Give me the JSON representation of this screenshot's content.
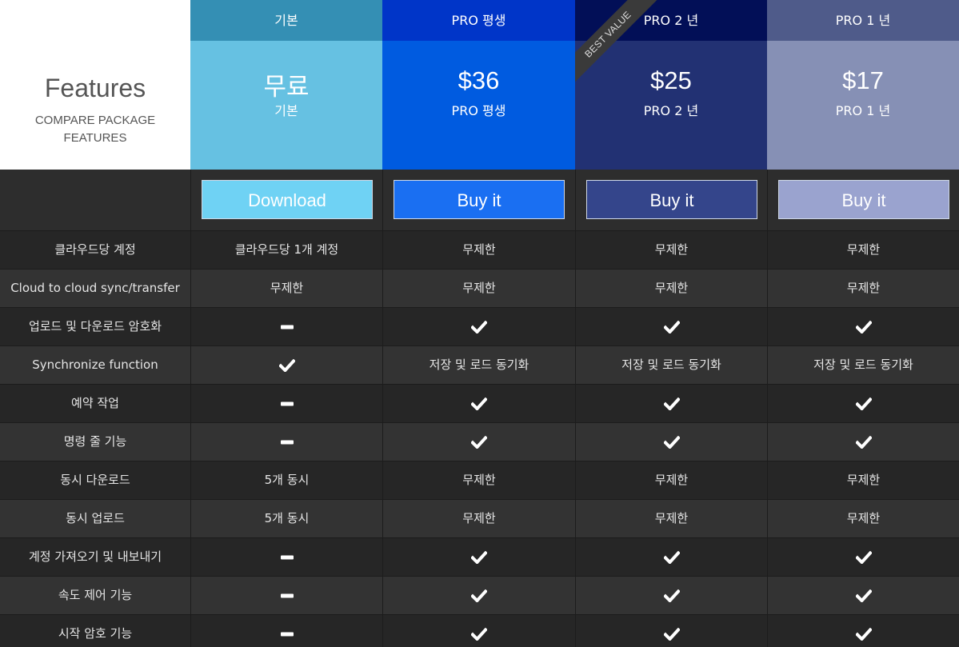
{
  "features_header": {
    "title": "Features",
    "subtitle": "COMPARE PACKAGE FEATURES"
  },
  "plans": [
    {
      "top_label": "기본",
      "price": "무료",
      "sub_label": "기본",
      "button": "Download",
      "ribbon": ""
    },
    {
      "top_label": "PRO 평생",
      "price": "$36",
      "sub_label": "PRO 평생",
      "button": "Buy it",
      "ribbon": ""
    },
    {
      "top_label": "PRO 2 년",
      "price": "$25",
      "sub_label": "PRO 2 년",
      "button": "Buy it",
      "ribbon": "BEST VALUE"
    },
    {
      "top_label": "PRO 1 년",
      "price": "$17",
      "sub_label": "PRO 1 년",
      "button": "Buy it",
      "ribbon": ""
    }
  ],
  "rows": [
    {
      "feature": "클라우드당 계정",
      "values": [
        "클라우드당 1개 계정",
        "무제한",
        "무제한",
        "무제한"
      ]
    },
    {
      "feature": "Cloud to cloud  sync/transfer",
      "values": [
        "무제한",
        "무제한",
        "무제한",
        "무제한"
      ]
    },
    {
      "feature": "업로드 및 다운로드 암호화",
      "values": [
        "dash-icon",
        "check-icon",
        "check-icon",
        "check-icon"
      ]
    },
    {
      "feature": "Synchronize function",
      "values": [
        "check-icon",
        "저장 및 로드 동기화",
        "저장 및 로드 동기화",
        "저장 및 로드 동기화"
      ]
    },
    {
      "feature": "예약 작업",
      "values": [
        "dash-icon",
        "check-icon",
        "check-icon",
        "check-icon"
      ]
    },
    {
      "feature": "명령 줄 기능",
      "values": [
        "dash-icon",
        "check-icon",
        "check-icon",
        "check-icon"
      ]
    },
    {
      "feature": "동시 다운로드",
      "values": [
        "5개 동시",
        "무제한",
        "무제한",
        "무제한"
      ]
    },
    {
      "feature": "동시 업로드",
      "values": [
        "5개 동시",
        "무제한",
        "무제한",
        "무제한"
      ]
    },
    {
      "feature": "계정 가져오기 및 내보내기",
      "values": [
        "dash-icon",
        "check-icon",
        "check-icon",
        "check-icon"
      ]
    },
    {
      "feature": "속도 제어 기능",
      "values": [
        "dash-icon",
        "check-icon",
        "check-icon",
        "check-icon"
      ]
    },
    {
      "feature": "시작 암호 기능",
      "values": [
        "dash-icon",
        "check-icon",
        "check-icon",
        "check-icon"
      ]
    }
  ]
}
